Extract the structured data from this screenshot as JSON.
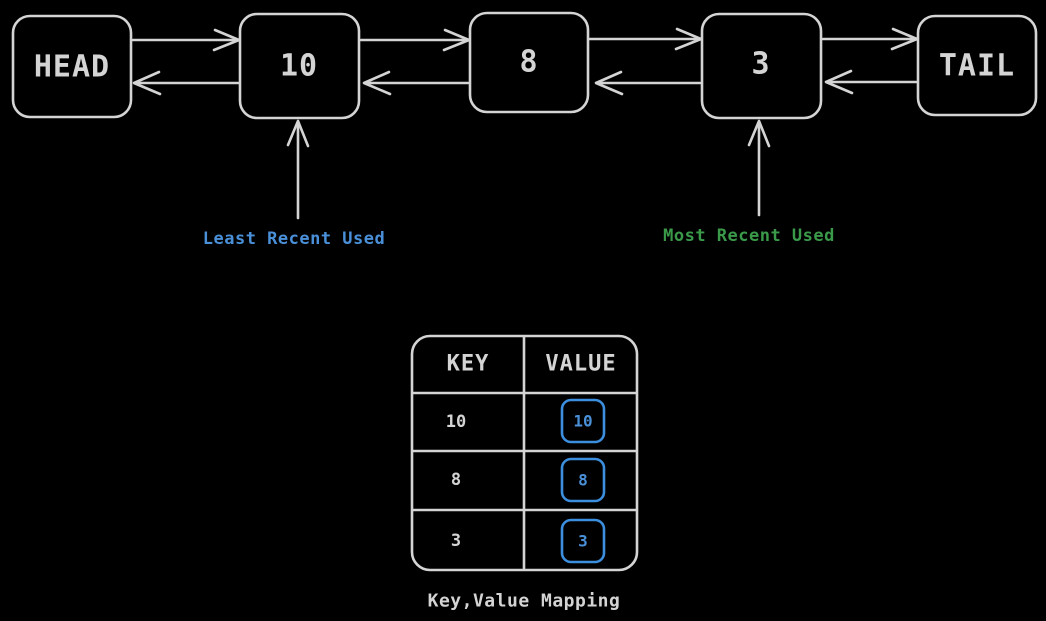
{
  "diagram": {
    "title_caption": "Key,Value Mapping",
    "colors": {
      "background": "#000000",
      "stroke": "#d4d4d4",
      "text": "#d4d4d4",
      "lru_accent": "#4a90d9",
      "mru_accent": "#3a9a4a",
      "chip_accent": "#3c8ede"
    },
    "list": {
      "head_label": "HEAD",
      "tail_label": "TAIL",
      "nodes": [
        {
          "label": "10"
        },
        {
          "label": "8"
        },
        {
          "label": "3"
        }
      ]
    },
    "annotations": [
      {
        "id": "lru",
        "label": "Least Recent Used",
        "color": "#4a90d9",
        "points_to": "10"
      },
      {
        "id": "mru",
        "label": "Most Recent Used",
        "color": "#3a9a4a",
        "points_to": "3"
      }
    ],
    "table": {
      "headers": [
        "KEY",
        "VALUE"
      ],
      "rows": [
        {
          "key": "10",
          "value": "10"
        },
        {
          "key": "8",
          "value": "8"
        },
        {
          "key": "3",
          "value": "3"
        }
      ],
      "caption": "Key,Value Mapping"
    }
  }
}
